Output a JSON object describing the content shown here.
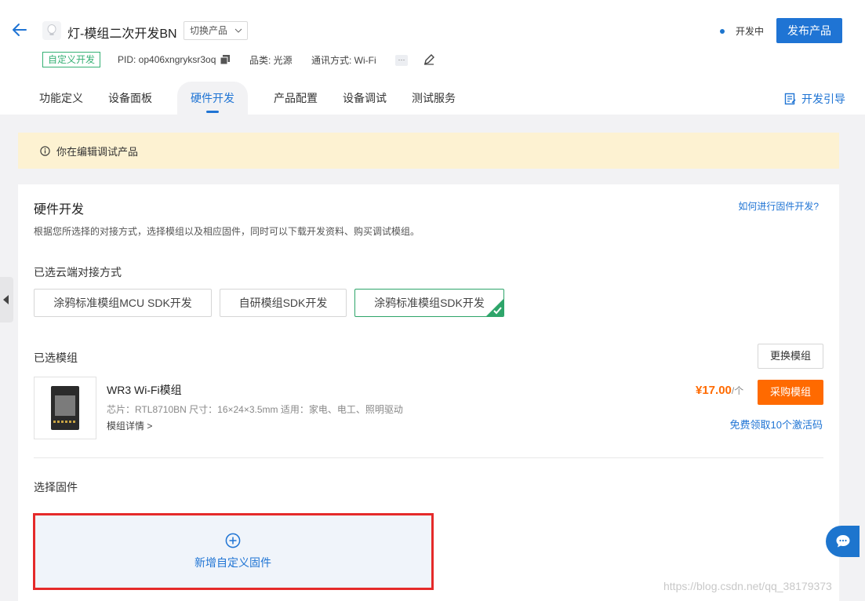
{
  "header": {
    "product_name": "灯-模组二次开发BN",
    "switch_label": "切换产品",
    "status": "开发中",
    "publish_label": "发布产品",
    "custom_tag": "自定义开发",
    "pid": "PID: op406xngryksr3oq",
    "category": "品类: 光源",
    "protocol": "通讯方式: Wi-Fi",
    "more": "···"
  },
  "tabs": [
    "功能定义",
    "设备面板",
    "硬件开发",
    "产品配置",
    "设备调试",
    "测试服务"
  ],
  "active_tab": "硬件开发",
  "guide_label": "开发引导",
  "notice": "你在编辑调试产品",
  "card": {
    "title": "硬件开发",
    "help_link": "如何进行固件开发?",
    "description": "根据您所选择的对接方式，选择模组以及相应固件，同时可以下载开发资料、购买调试模组。",
    "cloud_label": "已选云端对接方式",
    "options": [
      "涂鸦标准模组MCU SDK开发",
      "自研模组SDK开发",
      "涂鸦标准模组SDK开发"
    ],
    "selected_option": "涂鸦标准模组SDK开发",
    "module_label": "已选模组",
    "change_module": "更换模组",
    "module": {
      "name": "WR3 Wi-Fi模组",
      "spec": "芯片：RTL8710BN   尺寸：16×24×3.5mm   适用：家电、电工、照明驱动",
      "detail": "模组详情 >",
      "price": "¥17.00",
      "unit": "/个",
      "buy": "采购模组",
      "free_link": "免费领取10个激活码"
    },
    "firmware_label": "选择固件",
    "add_firmware": "新增自定义固件"
  },
  "watermark": "https://blog.csdn.net/qq_38179373",
  "colors": {
    "primary": "#1f74d4",
    "accent_orange": "#ff6a00",
    "success_green": "#2ea56a",
    "notice_bg": "#fdf2d2",
    "highlight_red": "#e52a2a"
  }
}
